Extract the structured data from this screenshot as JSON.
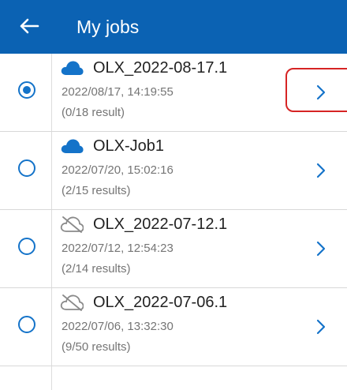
{
  "header": {
    "title": "My jobs",
    "back_icon": "arrow-left-icon",
    "background": "#0b62b3"
  },
  "jobs": [
    {
      "name": "OLX_2022-08-17.1",
      "date": "2022/08/17, 14:19:55",
      "results": "(0/18 result)",
      "selected": true,
      "cloud_status": "cloud-icon"
    },
    {
      "name": "OLX-Job1",
      "date": "2022/07/20, 15:02:16",
      "results": "(2/15 results)",
      "selected": false,
      "cloud_status": "cloud-icon"
    },
    {
      "name": "OLX_2022-07-12.1",
      "date": "2022/07/12, 12:54:23",
      "results": "(2/14 results)",
      "selected": false,
      "cloud_status": "cloud-off-icon"
    },
    {
      "name": "OLX_2022-07-06.1",
      "date": "2022/07/06, 13:32:30",
      "results": "(9/50 results)",
      "selected": false,
      "cloud_status": "cloud-off-icon"
    }
  ],
  "colors": {
    "accent": "#1473c9",
    "highlight": "#d62424"
  }
}
